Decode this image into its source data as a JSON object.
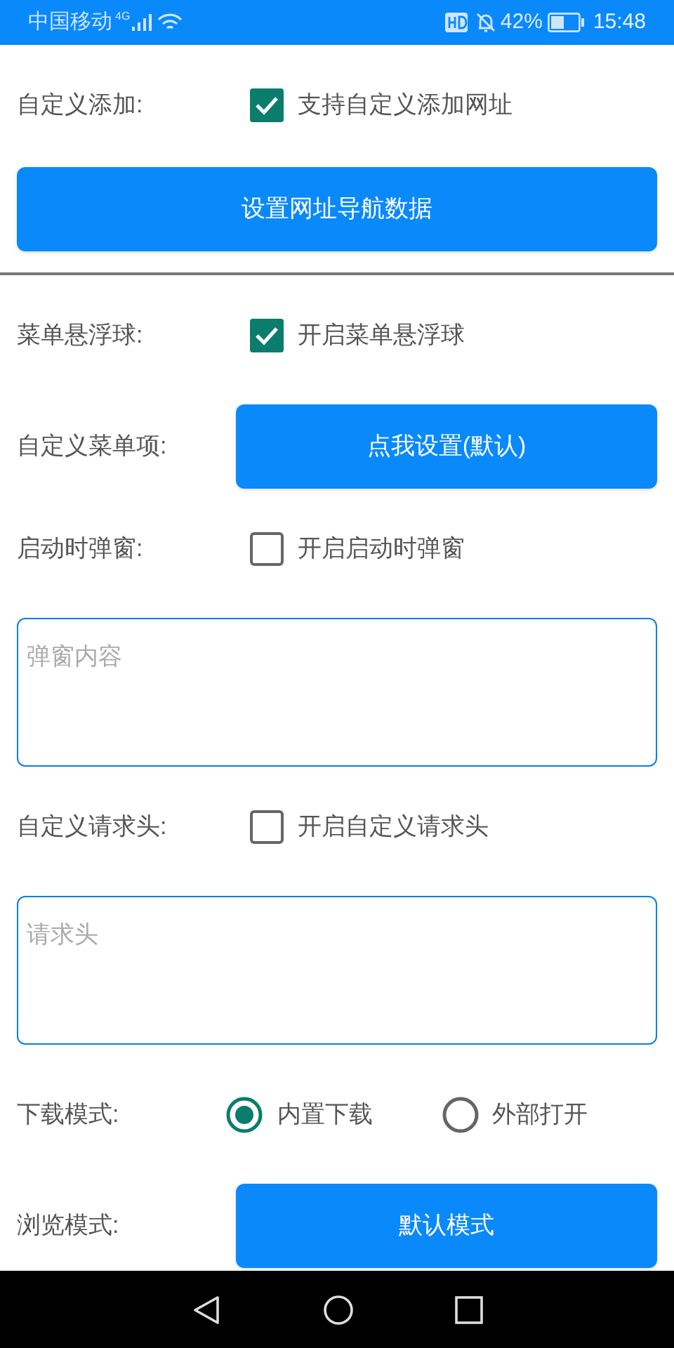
{
  "status_bar": {
    "carrier": "中国移动",
    "network": "4G",
    "battery": "42%",
    "time": "15:48"
  },
  "items": [
    {
      "kind": "checkbox",
      "label": "自定义添加:",
      "text": "支持自定义添加网址",
      "checked": true
    },
    {
      "kind": "wide_button",
      "text": "设置网址导航数据"
    },
    {
      "kind": "divider"
    },
    {
      "kind": "checkbox",
      "label": "菜单悬浮球:",
      "text": "开启菜单悬浮球",
      "checked": true
    },
    {
      "kind": "button",
      "label": "自定义菜单项:",
      "text": "点我设置(默认)"
    },
    {
      "kind": "checkbox",
      "label": "启动时弹窗:",
      "text": "开启启动时弹窗",
      "checked": false
    },
    {
      "kind": "textarea",
      "placeholder": "弹窗内容"
    },
    {
      "kind": "checkbox",
      "label": "自定义请求头:",
      "text": "开启自定义请求头",
      "checked": false
    },
    {
      "kind": "textarea",
      "placeholder": "请求头"
    },
    {
      "kind": "radio",
      "label": "下载模式:",
      "options": [
        {
          "text": "内置下载",
          "selected": true
        },
        {
          "text": "外部打开",
          "selected": false
        }
      ]
    },
    {
      "kind": "button",
      "label": "浏览模式:",
      "text": "默认模式"
    }
  ]
}
